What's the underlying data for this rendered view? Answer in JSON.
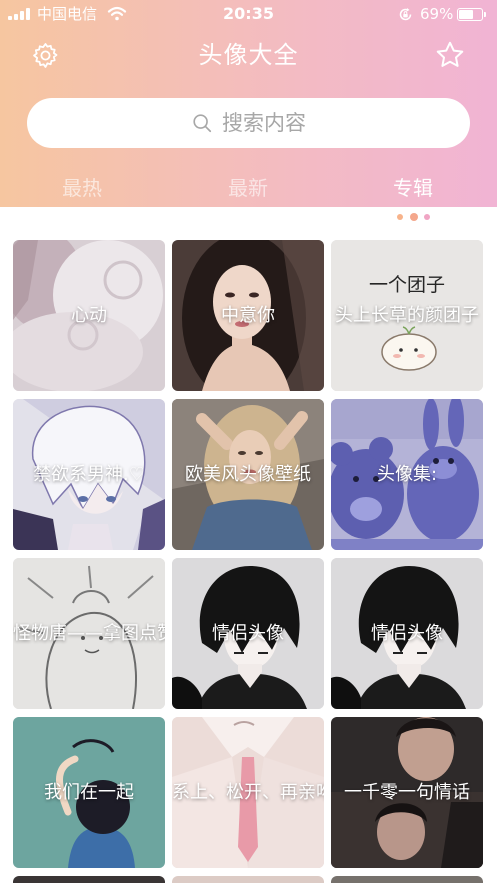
{
  "status_bar": {
    "carrier": "中国电信",
    "time": "20:35",
    "battery": "69%",
    "signal_icon": "signal-bars-icon",
    "wifi_icon": "wifi-icon",
    "rotation_lock_icon": "rotation-lock-icon",
    "battery_icon": "battery-icon"
  },
  "header": {
    "title": "头像大全",
    "left_icon": "gear-icon",
    "right_icon": "star-icon"
  },
  "search": {
    "placeholder": "搜索内容",
    "icon": "search-icon"
  },
  "tabs": [
    {
      "label": "最热",
      "active": false
    },
    {
      "label": "最新",
      "active": false
    },
    {
      "label": "专辑",
      "active": true
    }
  ],
  "theme": {
    "gradient_start": "#f6c6a0",
    "gradient_mid": "#f3bbc3",
    "gradient_end": "#f1b4d4",
    "tab_active": "#ffffff",
    "tab_inactive": "#ffffff99",
    "indicator_dots": [
      "#f7b38b",
      "#f4a78c",
      "#f0a5c4"
    ],
    "card_title": "#ffffff"
  },
  "albums": [
    {
      "title": "心动"
    },
    {
      "title": "中意你"
    },
    {
      "title": "头上长草的颜团子",
      "cover_text": "一个团子"
    },
    {
      "title": "禁欲系男神.♡"
    },
    {
      "title": "欧美风头像壁纸"
    },
    {
      "title": "头像集:"
    },
    {
      "title": "怪物唐——拿图点赞"
    },
    {
      "title": "情侣头像"
    },
    {
      "title": "情侣头像"
    },
    {
      "title": "我们在一起"
    },
    {
      "title": "系上、松开、再亲吻"
    },
    {
      "title": "一千零一句情话"
    }
  ]
}
